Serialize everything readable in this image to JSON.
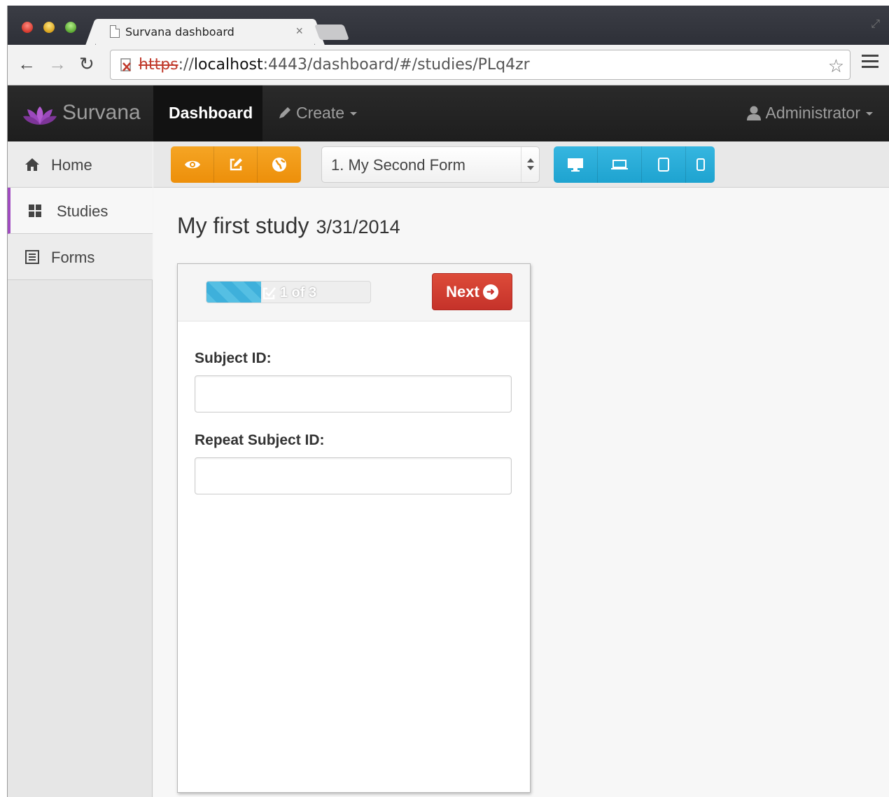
{
  "browser": {
    "tab_title": "Survana dashboard",
    "tab_close": "×",
    "url_scheme": "https",
    "url_sep": "://",
    "url_host": "localhost",
    "url_rest": ":4443/dashboard/#/studies/PLq4zr"
  },
  "navbar": {
    "brand": "Survana",
    "dashboard": "Dashboard",
    "create": "Create",
    "user": "Administrator"
  },
  "sidebar": {
    "items": [
      {
        "label": "Home",
        "icon": "home-icon"
      },
      {
        "label": "Studies",
        "icon": "grid-icon",
        "active": true
      },
      {
        "label": "Forms",
        "icon": "list-icon"
      }
    ]
  },
  "toolbar": {
    "selected_form": "1. My Second Form",
    "view_buttons": [
      "preview",
      "edit",
      "publish"
    ],
    "device_buttons": [
      "desktop",
      "laptop",
      "tablet",
      "phone"
    ]
  },
  "study": {
    "title": "My first study",
    "date": "3/31/2014"
  },
  "form": {
    "progress_text": "1 of 3",
    "progress_value": 0.333,
    "next_label": "Next",
    "fields": [
      {
        "label": "Subject ID:",
        "value": ""
      },
      {
        "label": "Repeat Subject ID:",
        "value": ""
      }
    ]
  },
  "colors": {
    "accent_purple": "#a04cc0",
    "orange": "#f0991a",
    "blue": "#2aaed9",
    "red": "#d9432f"
  }
}
